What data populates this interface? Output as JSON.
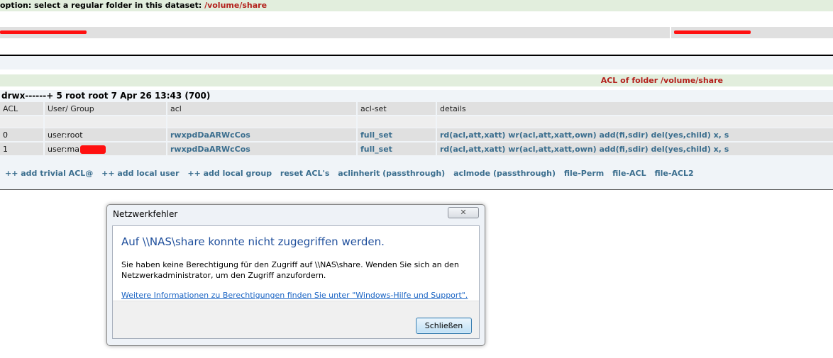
{
  "option_bar": {
    "label": "option: select a regular folder in this dataset: ",
    "path": "/volume/share"
  },
  "acl_section": {
    "title": "ACL of folder /volume/share",
    "permissions": "drwx------+ 5 root root 7 Apr 26 13:43 (700)"
  },
  "table": {
    "headers": [
      "ACL",
      "User/ Group",
      "acl",
      "acl-set",
      "details"
    ],
    "rows": [
      {
        "index": "0",
        "user": "user:root",
        "acl": "rwxpdDaARWcCos",
        "aclset": "full_set",
        "details": "rd(acl,att,xatt) wr(acl,att,xatt,own) add(fi,sdir) del(yes,child) x, s"
      },
      {
        "index": "1",
        "user": "user:ma",
        "acl": "rwxpdDaARWcCos",
        "aclset": "full_set",
        "details": "rd(acl,att,xatt) wr(acl,att,xatt,own) add(fi,sdir) del(yes,child) x, s"
      }
    ]
  },
  "actions": [
    "++ add trivial ACL@",
    "++ add local user",
    "++ add local group",
    "reset ACL's",
    "aclinherit (passthrough)",
    "aclmode (passthrough)",
    "file-Perm",
    "file-ACL",
    "file-ACL2"
  ],
  "dialog": {
    "title": "Netzwerkfehler",
    "heading": "Auf \\\\NAS\\share konnte nicht zugegriffen werden.",
    "message": "Sie haben keine Berechtigung für den Zugriff auf \\\\NAS\\share. Wenden Sie sich an den Netzwerkadministrator, um den Zugriff anzufordern.",
    "link": "Weitere Informationen zu Berechtigungen finden Sie unter \"Windows-Hilfe und Support\".",
    "button": "Schließen",
    "close_icon": "close-x-icon"
  },
  "colors": {
    "accent_red": "#b3201b",
    "link_teal": "#3b6e8e",
    "redaction": "#ff1010",
    "dialog_heading": "#1f4f9c"
  }
}
